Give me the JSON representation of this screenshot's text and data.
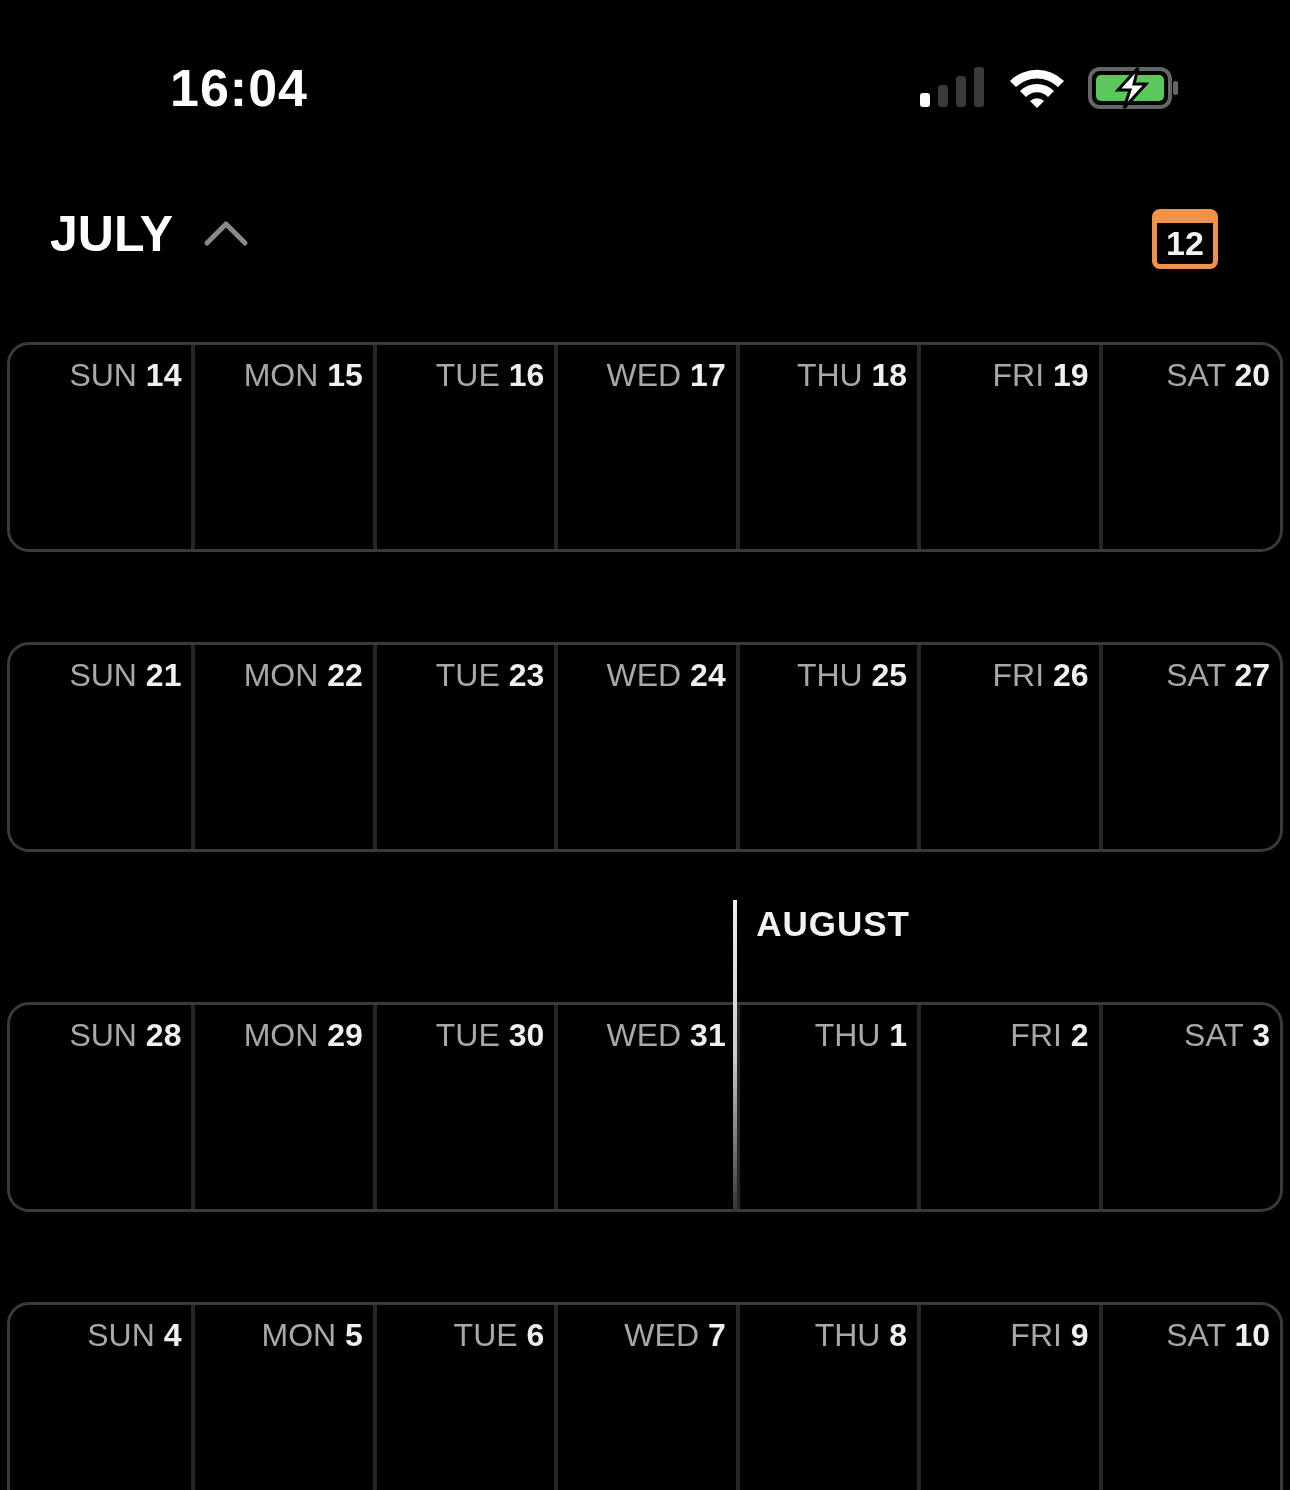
{
  "status_bar": {
    "time": "16:04"
  },
  "header": {
    "month": "JULY",
    "today_badge": "12"
  },
  "weeks": [
    {
      "days": [
        {
          "weekday": "SUN",
          "day": "14"
        },
        {
          "weekday": "MON",
          "day": "15"
        },
        {
          "weekday": "TUE",
          "day": "16"
        },
        {
          "weekday": "WED",
          "day": "17"
        },
        {
          "weekday": "THU",
          "day": "18"
        },
        {
          "weekday": "FRI",
          "day": "19"
        },
        {
          "weekday": "SAT",
          "day": "20"
        }
      ]
    },
    {
      "days": [
        {
          "weekday": "SUN",
          "day": "21"
        },
        {
          "weekday": "MON",
          "day": "22"
        },
        {
          "weekday": "TUE",
          "day": "23"
        },
        {
          "weekday": "WED",
          "day": "24"
        },
        {
          "weekday": "THU",
          "day": "25"
        },
        {
          "weekday": "FRI",
          "day": "26"
        },
        {
          "weekday": "SAT",
          "day": "27"
        }
      ]
    },
    {
      "month_label": "AUGUST",
      "days": [
        {
          "weekday": "SUN",
          "day": "28"
        },
        {
          "weekday": "MON",
          "day": "29"
        },
        {
          "weekday": "TUE",
          "day": "30"
        },
        {
          "weekday": "WED",
          "day": "31"
        },
        {
          "weekday": "THU",
          "day": "1",
          "month_start": true
        },
        {
          "weekday": "FRI",
          "day": "2"
        },
        {
          "weekday": "SAT",
          "day": "3"
        }
      ]
    },
    {
      "days": [
        {
          "weekday": "SUN",
          "day": "4"
        },
        {
          "weekday": "MON",
          "day": "5"
        },
        {
          "weekday": "TUE",
          "day": "6"
        },
        {
          "weekday": "WED",
          "day": "7"
        },
        {
          "weekday": "THU",
          "day": "8"
        },
        {
          "weekday": "FRI",
          "day": "9"
        },
        {
          "weekday": "SAT",
          "day": "10"
        }
      ]
    }
  ]
}
